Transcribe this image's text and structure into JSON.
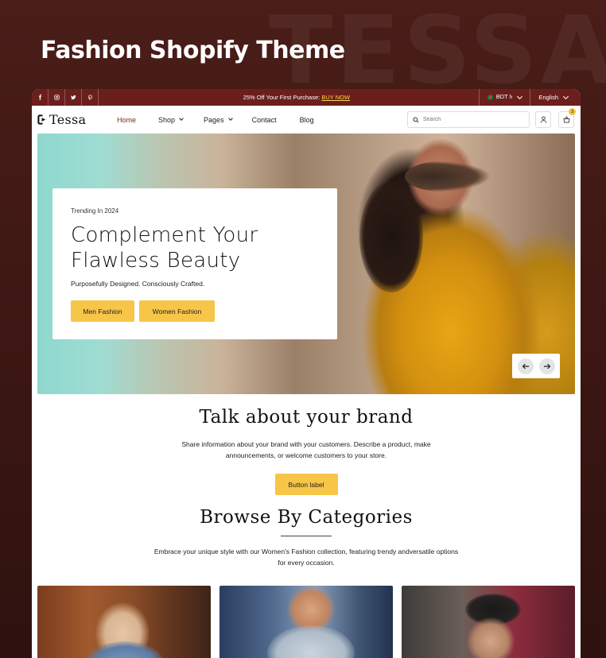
{
  "promo": {
    "title": "Fashion Shopify Theme",
    "bg_word": "TESSA"
  },
  "topbar": {
    "socials": [
      "facebook-icon",
      "instagram-icon",
      "twitter-icon",
      "pinterest-icon"
    ],
    "announcement": "25% Off Your First Purchase:",
    "announcement_link": "BUY NOW",
    "currency": "BDT ৳",
    "language": "English"
  },
  "header": {
    "logo": "Tessa",
    "nav": [
      {
        "label": "Home",
        "active": true
      },
      {
        "label": "Shop",
        "dropdown": true
      },
      {
        "label": "Pages",
        "dropdown": true
      },
      {
        "label": "Contact"
      },
      {
        "label": "Blog"
      }
    ],
    "search_placeholder": "Search",
    "cart_count": "3"
  },
  "hero": {
    "eyebrow": "Trending In 2024",
    "title_line1": "Complement Your",
    "title_line2": "Flawless Beauty",
    "subtitle": "Purposefully Designed. Consciously Crafted.",
    "btn_men": "Men Fashion",
    "btn_women": "Women Fashion"
  },
  "brand": {
    "title": "Talk about your brand",
    "text": "Share information about your brand with your customers. Describe a product, make announcements, or welcome customers to your store.",
    "button": "Button label"
  },
  "categories": {
    "title": "Browse By Categories",
    "text": "Embrace your unique style with our Women's Fashion collection, featuring trendy andversatile options for every occasion."
  },
  "colors": {
    "accent": "#f7c548",
    "topbar": "#6b1f1c",
    "background": "#3e1814"
  }
}
